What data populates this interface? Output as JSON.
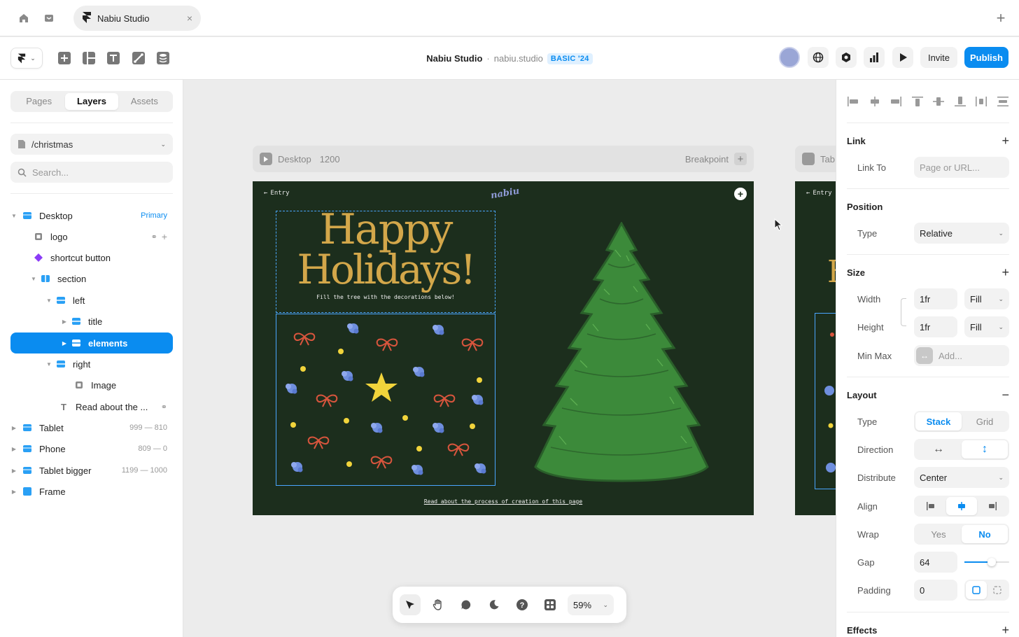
{
  "tabs": {
    "doc_title": "Nabiu Studio",
    "icons": [
      "home-icon",
      "inbox-icon",
      "framer-logo-icon",
      "close-icon",
      "plus-icon"
    ]
  },
  "toolbar": {
    "project_name": "Nabiu Studio",
    "separator": "·",
    "domain": "nabiu.studio",
    "badge": "BASIC '24",
    "invite": "Invite",
    "publish": "Publish",
    "accent": "#0a8cf0"
  },
  "left": {
    "tabs": [
      "Pages",
      "Layers",
      "Assets"
    ],
    "active_tab": "Layers",
    "page": "/christmas",
    "search_placeholder": "Search...",
    "layers": [
      {
        "label": "Desktop",
        "meta": "Primary"
      },
      {
        "label": "logo"
      },
      {
        "label": "shortcut button"
      },
      {
        "label": "section"
      },
      {
        "label": "left"
      },
      {
        "label": "title"
      },
      {
        "label": "elements"
      },
      {
        "label": "right"
      },
      {
        "label": "Image"
      },
      {
        "label": "Read about the ..."
      },
      {
        "label": "Tablet",
        "meta": "999 — 810"
      },
      {
        "label": "Phone",
        "meta": "809 — 0"
      },
      {
        "label": "Tablet bigger",
        "meta": "1199 — 1000"
      },
      {
        "label": "Frame"
      }
    ]
  },
  "canvas": {
    "breakpoint_name": "Desktop",
    "breakpoint_width": "1200",
    "breakpoint_label": "Breakpoint",
    "second_name": "Tab",
    "entry": "Entry",
    "logo": "nabiu",
    "heading_line1": "Happy",
    "heading_line2": "Holidays!",
    "subtitle": "Fill the tree with the decorations below!",
    "footer_link": "Read about the process of creation of this page",
    "zoom": "59%"
  },
  "right": {
    "link": {
      "title": "Link",
      "link_to_label": "Link To",
      "placeholder": "Page or URL..."
    },
    "position": {
      "title": "Position",
      "type_label": "Type",
      "type_value": "Relative"
    },
    "size": {
      "title": "Size",
      "width_label": "Width",
      "width_value": "1fr",
      "width_mode": "Fill",
      "height_label": "Height",
      "height_value": "1fr",
      "height_mode": "Fill",
      "minmax_label": "Min Max",
      "minmax_placeholder": "Add..."
    },
    "layout": {
      "title": "Layout",
      "type_label": "Type",
      "type_options": [
        "Stack",
        "Grid"
      ],
      "direction_label": "Direction",
      "distribute_label": "Distribute",
      "distribute_value": "Center",
      "align_label": "Align",
      "wrap_label": "Wrap",
      "wrap_options": [
        "Yes",
        "No"
      ],
      "gap_label": "Gap",
      "gap_value": "64",
      "padding_label": "Padding",
      "padding_value": "0"
    },
    "effects": {
      "title": "Effects"
    }
  }
}
